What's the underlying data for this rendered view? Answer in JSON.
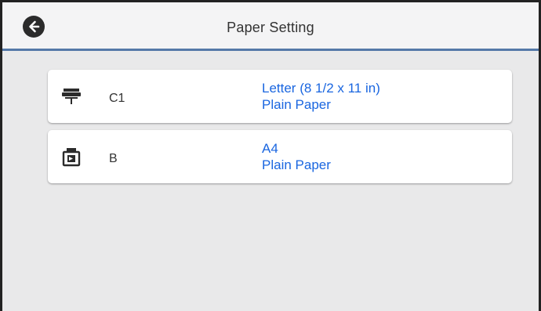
{
  "header": {
    "title": "Paper Setting",
    "back_icon": "arrow-left-icon"
  },
  "sources": [
    {
      "label": "C1",
      "icon": "rear-paper-feed-icon",
      "paper_size": "Letter (8 1/2 x 11 in)",
      "paper_type": "Plain Paper"
    },
    {
      "label": "B",
      "icon": "paper-cassette-icon",
      "paper_size": "A4",
      "paper_type": "Plain Paper"
    }
  ],
  "colors": {
    "accent_blue": "#1a66e0",
    "header_rule": "#5579a8",
    "background": "#e9e9ea"
  }
}
